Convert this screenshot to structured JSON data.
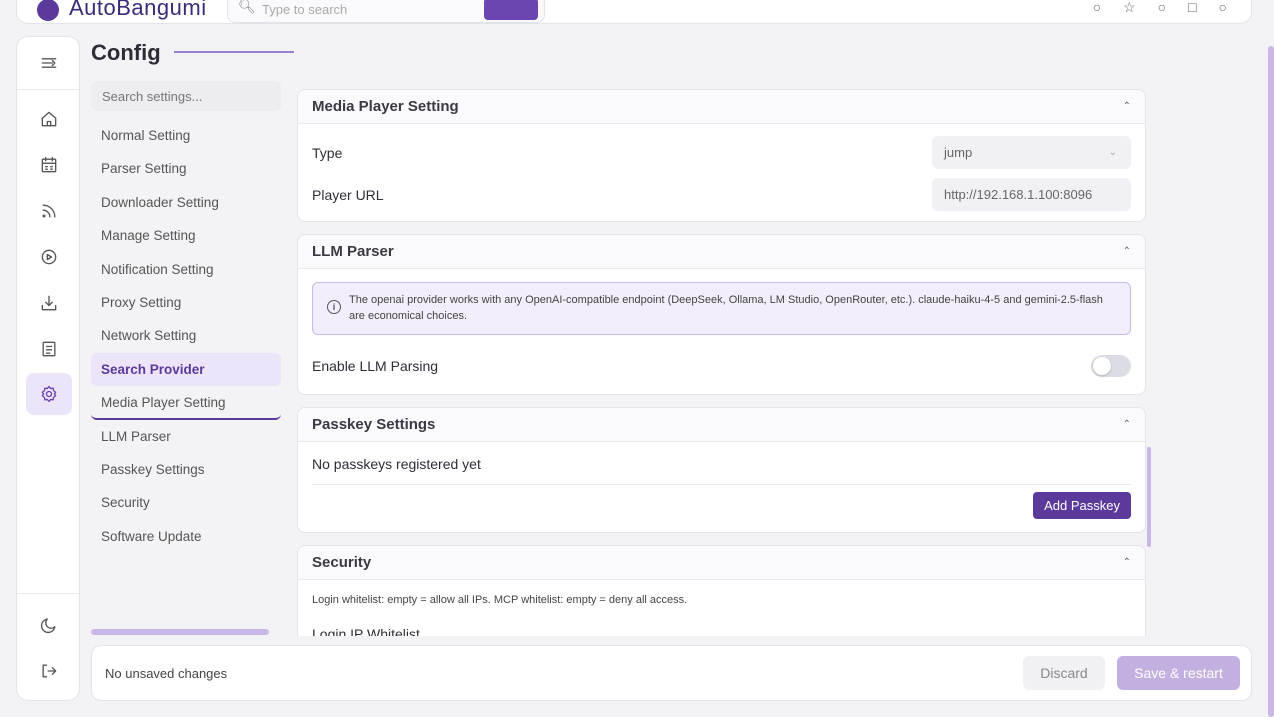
{
  "app": {
    "name": "AutoBangumi"
  },
  "topbar": {
    "search_placeholder": "Type to search"
  },
  "page": {
    "title": "Config"
  },
  "settings_search": {
    "placeholder": "Search settings..."
  },
  "nav": {
    "items": [
      {
        "label": "Normal Setting"
      },
      {
        "label": "Parser Setting"
      },
      {
        "label": "Downloader Setting"
      },
      {
        "label": "Manage Setting"
      },
      {
        "label": "Notification Setting"
      },
      {
        "label": "Proxy Setting"
      },
      {
        "label": "Network Setting"
      },
      {
        "label": "Search Provider"
      },
      {
        "label": "Media Player Setting"
      },
      {
        "label": "LLM Parser"
      },
      {
        "label": "Passkey Settings"
      },
      {
        "label": "Security"
      },
      {
        "label": "Software Update"
      }
    ],
    "active": "Search Provider"
  },
  "media_player": {
    "title": "Media Player Setting",
    "type_label": "Type",
    "type_value": "jump",
    "url_label": "Player URL",
    "url_placeholder": "http://192.168.1.100:8096"
  },
  "llm_parser": {
    "title": "LLM Parser",
    "info": "The openai provider works with any OpenAI-compatible endpoint (DeepSeek, Ollama, LM Studio, OpenRouter, etc.). claude-haiku-4-5 and gemini-2.5-flash are economical choices.",
    "enable_label": "Enable LLM Parsing",
    "enabled": false
  },
  "passkey": {
    "title": "Passkey Settings",
    "empty_text": "No passkeys registered yet",
    "add_label": "Add Passkey"
  },
  "security": {
    "title": "Security",
    "hint": "Login whitelist: empty = allow all IPs. MCP whitelist: empty = deny all access.",
    "login_whitelist_label": "Login IP Whitelist"
  },
  "bottombar": {
    "status": "No unsaved changes",
    "discard_label": "Discard",
    "save_label": "Save & restart"
  },
  "colors": {
    "accent": "#5b3a9c",
    "accent_light": "#ece4f8"
  }
}
